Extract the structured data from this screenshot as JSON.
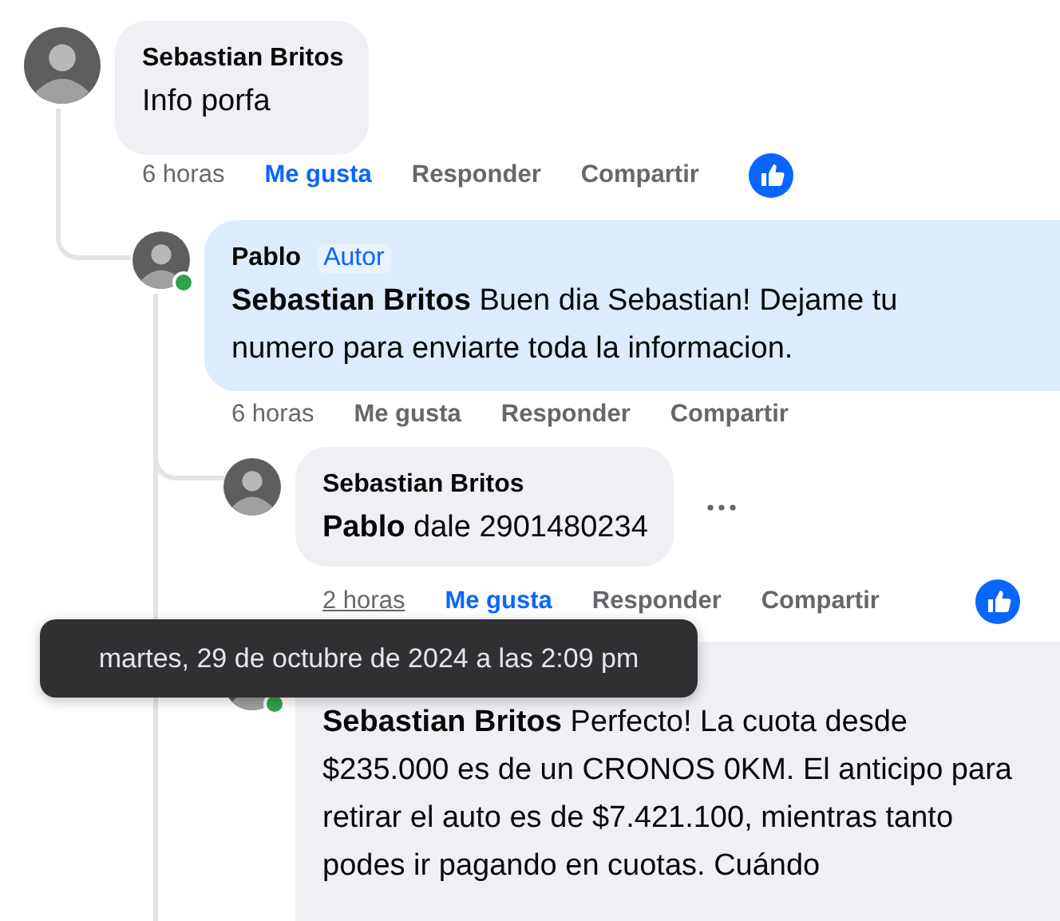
{
  "comments": [
    {
      "author": "Sebastian Britos",
      "text": "Info porfa",
      "time": "6 horas",
      "actions": {
        "like": "Me gusta",
        "reply": "Responder",
        "share": "Compartir"
      },
      "liked": true,
      "reacted": true,
      "children": [
        {
          "author": "Pablo",
          "badge": "Autor",
          "online": true,
          "highlighted": true,
          "text": "**Sebastian Britos** Buen dia Sebastian! Dejame tu numero para enviarte toda la informacion.",
          "time": "6 horas",
          "actions": {
            "like": "Me gusta",
            "reply": "Responder",
            "share": "Compartir"
          },
          "liked": false,
          "children": [
            {
              "author": "Sebastian Britos",
              "text": "**Pablo** dale 2901480234",
              "time": "2 horas",
              "time_hovered": true,
              "more_menu": true,
              "actions": {
                "like": "Me gusta",
                "reply": "Responder",
                "share": "Compartir"
              },
              "liked": true,
              "reacted": true
            },
            {
              "online": true,
              "highlighted": false,
              "text": "**Sebastian Britos** Perfecto! La cuota desde $235.000 es de un CRONOS 0KM. El anticipo para retirar el auto es de $7.421.100, mientras tanto podes ir pagando en cuotas. Cuándo"
            }
          ]
        }
      ]
    }
  ],
  "tooltip": {
    "text": "martes, 29 de octubre de 2024 a las 2:09 pm"
  }
}
